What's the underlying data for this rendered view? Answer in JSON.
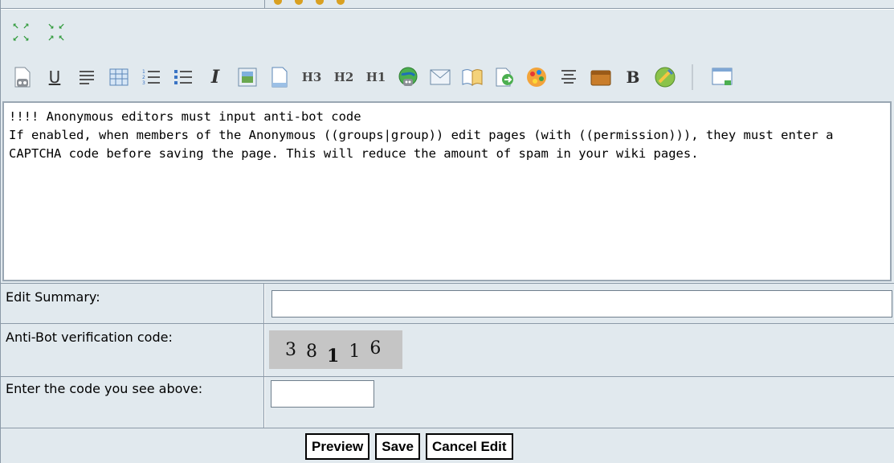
{
  "editor": {
    "content": "!!!! Anonymous editors must input anti-bot code\nIf enabled, when members of the Anonymous ((groups|group)) edit pages (with ((permission))), they must enter a CAPTCHA code before saving the page. This will reduce the amount of spam in your wiki pages."
  },
  "toolbar": {
    "resize_icons": [
      "enlarge-icon",
      "shrink-icon"
    ],
    "buttons": [
      {
        "name": "insert-plugin-icon",
        "text": ""
      },
      {
        "name": "underline-button",
        "text": "U"
      },
      {
        "name": "align-left-icon",
        "text": ""
      },
      {
        "name": "table-icon",
        "text": ""
      },
      {
        "name": "numbered-list-icon",
        "text": ""
      },
      {
        "name": "bullet-list-icon",
        "text": ""
      },
      {
        "name": "italic-button",
        "text": "I"
      },
      {
        "name": "insert-image-icon",
        "text": ""
      },
      {
        "name": "new-page-icon",
        "text": ""
      },
      {
        "name": "heading3-button",
        "text": "H3"
      },
      {
        "name": "heading2-button",
        "text": "H2"
      },
      {
        "name": "heading1-button",
        "text": "H1"
      },
      {
        "name": "external-link-icon",
        "text": ""
      },
      {
        "name": "email-icon",
        "text": ""
      },
      {
        "name": "wiki-link-icon",
        "text": ""
      },
      {
        "name": "replace-icon",
        "text": ""
      },
      {
        "name": "color-icon",
        "text": ""
      },
      {
        "name": "center-align-icon",
        "text": ""
      },
      {
        "name": "box-icon",
        "text": ""
      },
      {
        "name": "bold-button",
        "text": "B"
      },
      {
        "name": "spellcheck-icon",
        "text": ""
      },
      {
        "name": "fullscreen-icon",
        "text": ""
      }
    ]
  },
  "form": {
    "edit_summary_label": "Edit Summary:",
    "edit_summary_value": "",
    "captcha_label": "Anti-Bot verification code:",
    "captcha_digits": [
      "3",
      "8",
      "1",
      "1",
      "6"
    ],
    "code_label": "Enter the code you see above:",
    "code_value": ""
  },
  "actions": {
    "preview": "Preview",
    "save": "Save",
    "cancel": "Cancel Edit"
  },
  "colors": {
    "panel_bg": "#e1e9ee",
    "border": "#8c9aa8",
    "captcha_bg": "#c5c5c5"
  }
}
